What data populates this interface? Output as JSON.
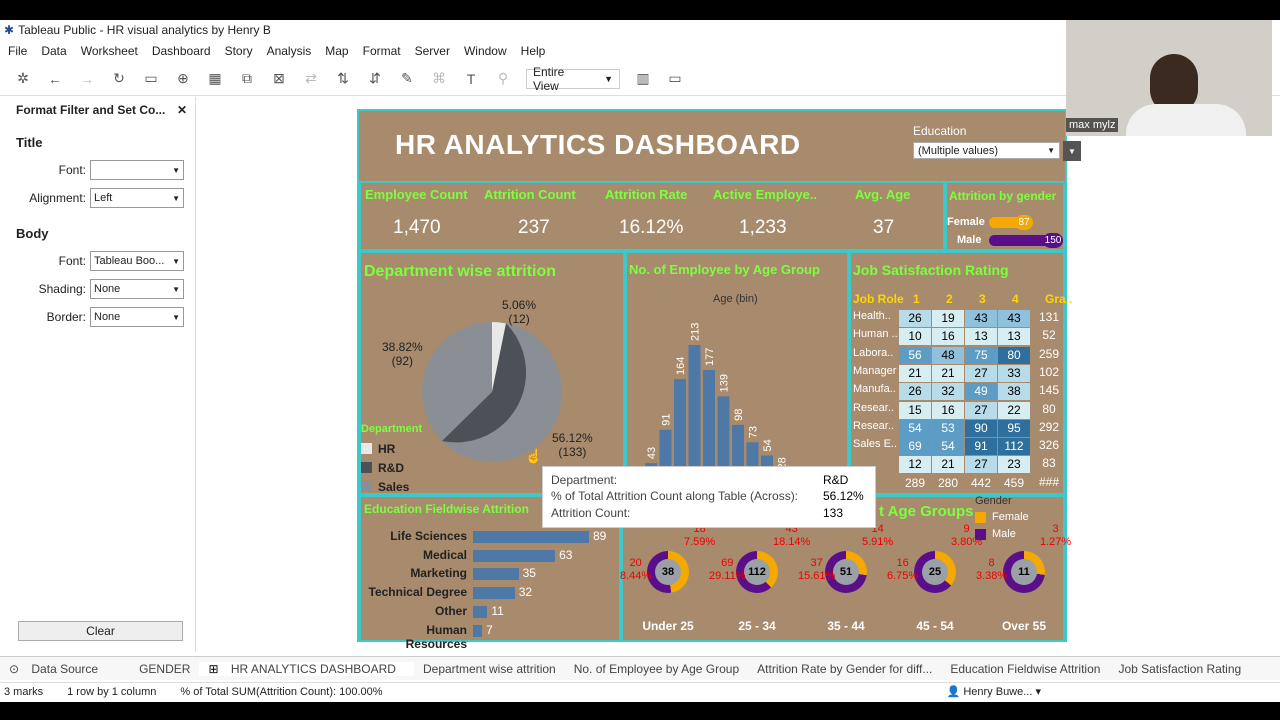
{
  "window": {
    "title": "Tableau Public - HR visual analytics by Henry B"
  },
  "menu": [
    "File",
    "Data",
    "Worksheet",
    "Dashboard",
    "Story",
    "Analysis",
    "Map",
    "Format",
    "Server",
    "Window",
    "Help"
  ],
  "toolbar": {
    "view": "Entire View"
  },
  "format_pane": {
    "title": "Format Filter and Set Co...",
    "title_section": "Title",
    "font_label": "Font:",
    "alignment_label": "Alignment:",
    "alignment_value": "Left",
    "body_section": "Body",
    "body_font_value": "Tableau Boo...",
    "shading_label": "Shading:",
    "shading_value": "None",
    "border_label": "Border:",
    "border_value": "None",
    "clear": "Clear"
  },
  "dashboard": {
    "title": "HR ANALYTICS DASHBOARD",
    "filter_label": "Education",
    "filter_value": "(Multiple values)",
    "kpis": [
      {
        "label": "Employee Count",
        "value": "1,470"
      },
      {
        "label": "Attrition Count",
        "value": "237"
      },
      {
        "label": "Attrition Rate",
        "value": "16.12%"
      },
      {
        "label": "Active Employe..",
        "value": "1,233"
      },
      {
        "label": "Avg. Age",
        "value": "37"
      }
    ],
    "gender": {
      "title": "Attrition by gender",
      "female_label": "Female",
      "female_value": "87",
      "male_label": "Male",
      "male_value": "150"
    },
    "dept": {
      "title": "Department wise attrition",
      "legend_title": "Department",
      "slices": [
        {
          "name": "HR",
          "pct": "5.06%",
          "count": "(12)",
          "value": 12,
          "color": "#e8e8e8"
        },
        {
          "name": "R&D",
          "pct": "56.12%",
          "count": "(133)",
          "value": 133,
          "color": "#4b5157"
        },
        {
          "name": "Sales",
          "pct": "38.82%",
          "count": "(92)",
          "value": 92,
          "color": "#8a8f96"
        }
      ]
    },
    "age_hist": {
      "title": "No. of Employee by Age Group",
      "xlabel": "Age (bin)"
    },
    "job_sat": {
      "title": "Job Satisfaction Rating",
      "headers": [
        "Job Role",
        "1",
        "2",
        "3",
        "4",
        "Gra.."
      ],
      "rows": [
        {
          "role": "Health..",
          "v": [
            "26",
            "19",
            "43",
            "43"
          ],
          "t": "131"
        },
        {
          "role": "Human ..",
          "v": [
            "10",
            "16",
            "13",
            "13"
          ],
          "t": "52"
        },
        {
          "role": "Labora..",
          "v": [
            "56",
            "48",
            "75",
            "80"
          ],
          "t": "259"
        },
        {
          "role": "Manager",
          "v": [
            "21",
            "21",
            "27",
            "33"
          ],
          "t": "102"
        },
        {
          "role": "Manufa..",
          "v": [
            "26",
            "32",
            "49",
            "38"
          ],
          "t": "145"
        },
        {
          "role": "Resear..",
          "v": [
            "15",
            "16",
            "27",
            "22"
          ],
          "t": "80"
        },
        {
          "role": "Resear..",
          "v": [
            "54",
            "53",
            "90",
            "95"
          ],
          "t": "292"
        },
        {
          "role": "Sales E..",
          "v": [
            "69",
            "54",
            "91",
            "112"
          ],
          "t": "326"
        },
        {
          "role": "",
          "v": [
            "12",
            "21",
            "27",
            "23"
          ],
          "t": "83"
        },
        {
          "role": "d",
          "v": [
            "289",
            "280",
            "442",
            "459"
          ],
          "t": "###"
        }
      ]
    },
    "education": {
      "title": "Education Fieldwise Attrition",
      "fields": [
        {
          "name": "Life Sciences",
          "value": "89"
        },
        {
          "name": "Medical",
          "value": "63"
        },
        {
          "name": "Marketing",
          "value": "35"
        },
        {
          "name": "Technical Degree",
          "value": "32"
        },
        {
          "name": "Other",
          "value": "11"
        },
        {
          "name": "Human Resources",
          "value": "7"
        }
      ]
    },
    "age_groups": {
      "title": "t Age Groups",
      "legend_title": "Gender",
      "legend_female": "Female",
      "legend_male": "Male",
      "groups": [
        {
          "label": "Under 25",
          "center": "38",
          "m": "18",
          "mp": "7.59%",
          "f": "20",
          "fp": "8.44%"
        },
        {
          "label": "25 - 34",
          "center": "112",
          "m": "43",
          "mp": "18.14%",
          "f": "69",
          "fp": "29.11%"
        },
        {
          "label": "35 - 44",
          "center": "51",
          "m": "14",
          "mp": "5.91%",
          "f": "37",
          "fp": "15.61%"
        },
        {
          "label": "45 - 54",
          "center": "25",
          "m": "9",
          "mp": "3.80%",
          "f": "16",
          "fp": "6.75%"
        },
        {
          "label": "Over 55",
          "center": "11",
          "m": "3",
          "mp": "1.27%",
          "f": "8",
          "fp": "3.38%"
        }
      ]
    },
    "tooltip": {
      "k1": "Department:",
      "v1": "R&D",
      "k2": "% of Total Attrition Count along Table (Across):",
      "v2": "56.12%",
      "k3": "Attrition Count:",
      "v3": "133"
    }
  },
  "chart_data": {
    "type": "bar",
    "title": "No. of Employee by Age Group",
    "xlabel": "Age (bin)",
    "values": [
      43,
      91,
      164,
      213,
      177,
      139,
      98,
      73,
      54,
      28
    ]
  },
  "webcam_name": "max mylz",
  "sheets": [
    "Data Source",
    "GENDER",
    "HR ANALYTICS DASHBOARD",
    "Department wise attrition",
    "No. of Employee by Age Group",
    "Attrition Rate by Gender for diff...",
    "Education Fieldwise Attrition",
    "Job Satisfaction Rating"
  ],
  "status": {
    "marks": "3 marks",
    "rows": "1 row by 1 column",
    "sum": "% of Total SUM(Attrition Count): 100.00%",
    "user": "Henry Buwe..."
  }
}
